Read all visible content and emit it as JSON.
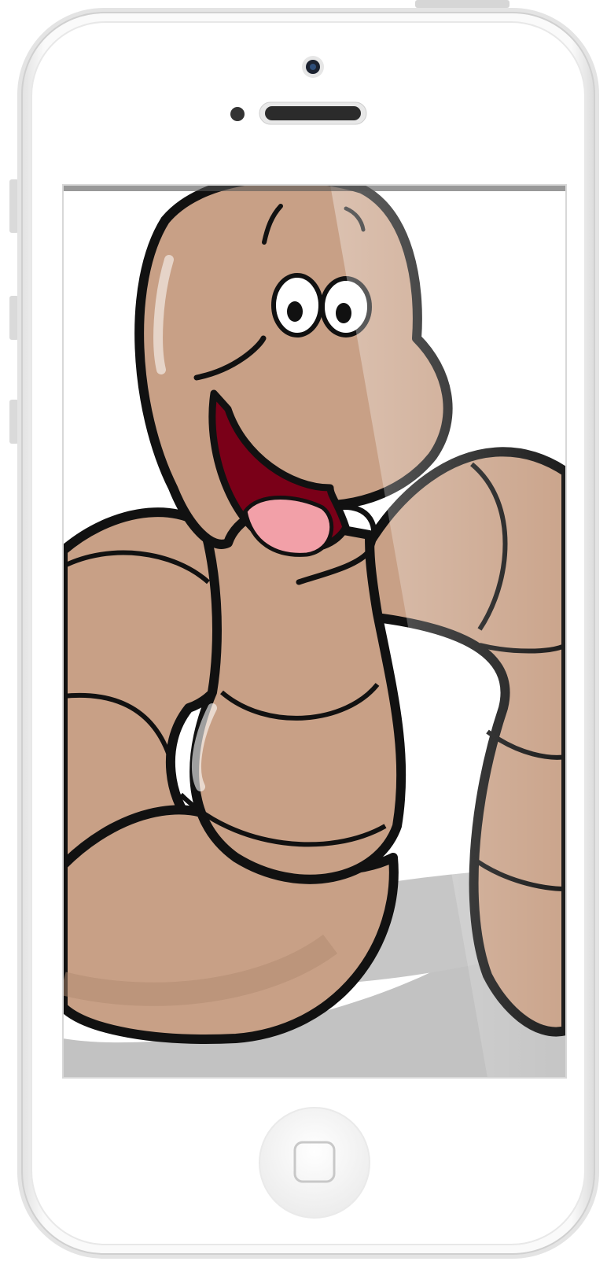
{
  "device": {
    "model": "smartphone",
    "color": "white",
    "frame_color": "#f4f4f4",
    "bezel_color": "#ffffff"
  },
  "screen": {
    "content": "cartoon-earthworm-illustration",
    "content_colors": {
      "worm_body": "#c8a086",
      "worm_shade": "#b08a70",
      "outline": "#111111",
      "mouth": "#7a0018",
      "tongue": "#f2a0a8",
      "shadow": "#c0c0c0"
    }
  },
  "controls": {
    "home_button_icon": "home-square-icon",
    "volume_up_icon": "volume-up-icon",
    "volume_down_icon": "volume-down-icon",
    "mute_switch_icon": "mute-switch-icon",
    "power_button_icon": "power-button-icon"
  }
}
